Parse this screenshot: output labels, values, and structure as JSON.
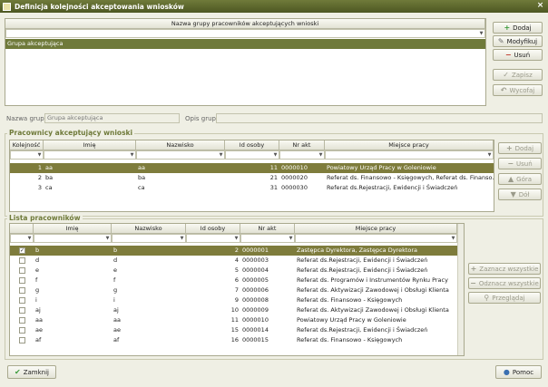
{
  "window": {
    "title": "Definicja kolejności akceptowania wniosków",
    "close": "×"
  },
  "top_grid": {
    "header": "Nazwa grupy pracowników akceptujących wnioski",
    "rows": [
      "Grupa akceptująca"
    ]
  },
  "buttons": {
    "add": "Dodaj",
    "modify": "Modyfikuj",
    "delete": "Usuń",
    "save": "Zapisz",
    "cancel": "Wycofaj",
    "close": "Zamknij",
    "help": "Pomoc"
  },
  "form": {
    "group_name_label": "Nazwa grupy:",
    "group_name_value": "Grupa akceptująca",
    "group_desc_label": "Opis grupy:",
    "group_desc_value": ""
  },
  "acceptors": {
    "title": "Pracownicy akceptujący wnioski",
    "columns": [
      "Kolejność",
      "Imię",
      "Nazwisko",
      "Id osoby",
      "Nr akt",
      "Miejsce pracy"
    ],
    "rows": [
      [
        "1",
        "aa",
        "aa",
        "11",
        "0000010",
        "Powiatowy Urząd Pracy w Goleniowie"
      ],
      [
        "2",
        "ba",
        "ba",
        "21",
        "0000020",
        "Referat ds. Finansowo - Księgowych, Referat ds. Finanso..."
      ],
      [
        "3",
        "ca",
        "ca",
        "31",
        "0000030",
        "Referat ds.Rejestracji, Ewidencji i Świadczeń"
      ]
    ],
    "btn_add": "Dodaj",
    "btn_delete": "Usuń",
    "btn_up": "Góra",
    "btn_down": "Dół"
  },
  "employees": {
    "title": "Lista pracowników",
    "columns": [
      "Imię",
      "Nazwisko",
      "Id osoby",
      "Nr akt",
      "Miejsce pracy"
    ],
    "rows": [
      [
        "✓",
        "b",
        "b",
        "2",
        "0000001",
        "Zastępca Dyrektora, Zastępca Dyrektora"
      ],
      [
        "",
        "d",
        "d",
        "4",
        "0000003",
        "Referat ds.Rejestracji, Ewidencji i Świadczeń"
      ],
      [
        "",
        "e",
        "e",
        "5",
        "0000004",
        "Referat ds.Rejestracji, Ewidencji i Świadczeń"
      ],
      [
        "",
        "f",
        "f",
        "6",
        "0000005",
        "Referat ds. Programów i Instrumentów Rynku Pracy"
      ],
      [
        "",
        "g",
        "g",
        "7",
        "0000006",
        "Referat ds. Aktywizacji Zawodowej i Obsługi Klienta"
      ],
      [
        "",
        "i",
        "i",
        "9",
        "0000008",
        "Referat ds. Finansowo - Księgowych"
      ],
      [
        "",
        "aj",
        "aj",
        "10",
        "0000009",
        "Referat ds. Aktywizacji Zawodowej i Obsługi Klienta"
      ],
      [
        "",
        "aa",
        "aa",
        "11",
        "0000010",
        "Powiatowy Urząd Pracy w Goleniowie"
      ],
      [
        "",
        "ae",
        "ae",
        "15",
        "0000014",
        "Referat ds.Rejestracji, Ewidencji i Świadczeń"
      ],
      [
        "",
        "af",
        "af",
        "16",
        "0000015",
        "Referat ds. Finansowo - Księgowych"
      ]
    ],
    "btn_select_all": "Zaznacz wszystkie",
    "btn_deselect_all": "Odznacz wszystkie",
    "btn_browse": "Przeglądaj"
  }
}
